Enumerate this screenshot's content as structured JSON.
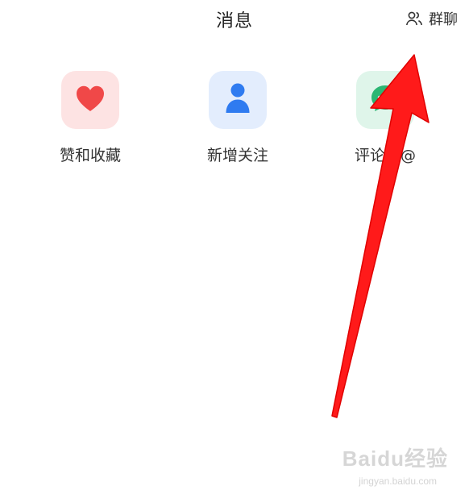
{
  "header": {
    "title": "消息",
    "group_chat": {
      "icon": "people-icon",
      "label": "群聊"
    }
  },
  "tiles": [
    {
      "label": "赞和收藏",
      "icon": "heart-icon",
      "color": "#f04848",
      "bg": "#fde3e3"
    },
    {
      "label": "新增关注",
      "icon": "person-icon",
      "color": "#2f7bf0",
      "bg": "#e3edfd"
    },
    {
      "label": "评论和@",
      "icon": "comment-icon",
      "color": "#2bb673",
      "bg": "#dff5ea"
    }
  ],
  "annotation": {
    "arrow_color": "#ff1a1a"
  },
  "watermark": {
    "text": "Baidu经验",
    "sub": "jingyan.baidu.com"
  }
}
